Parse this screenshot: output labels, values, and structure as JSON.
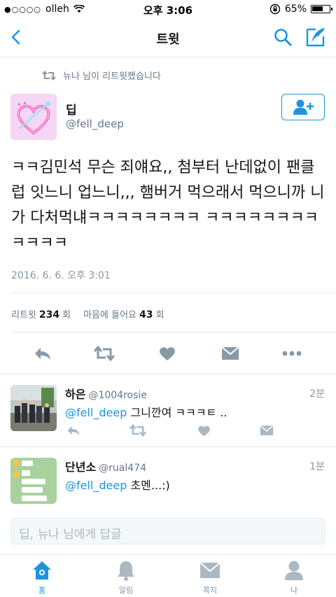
{
  "status_bar": {
    "signal": "●○○○○",
    "carrier": "olleh",
    "time": "오후 3:06",
    "battery": "65%",
    "battery_level": 0.65
  },
  "nav": {
    "title": "트윗"
  },
  "retweet_context": "뉴나 님이 리트윗했습니다",
  "tweet": {
    "author_name": "딥",
    "author_handle": "@fell_deep",
    "text": "ㅋㅋ김민석 무슨 죄얘요,, 첨부터 난데없이 팬클럽 잇느니 업느니,,, 햄버거 먹으래서 먹으니까 니가 다처먹냬ㅋㅋㅋㅋㅋㅋㅋㅋ ㅋㅋㅋㅋㅋㅋㅋㅋㅋㅋㅋㅋ",
    "timestamp": "2016. 6. 6. 오후 3:01",
    "retweet_label": "리트윗",
    "retweet_count": "234",
    "retweet_unit": "회",
    "like_label": "마음에 들어요",
    "like_count": "43",
    "like_unit": "회"
  },
  "replies": [
    {
      "name": "하은",
      "handle": "@1004rosie",
      "ago": "2분",
      "mention": "@fell_deep",
      "text": " 그니깐여 ㅋㅋㅋㅌ .."
    },
    {
      "name": "단년소",
      "handle": "@rual474",
      "ago": "1분",
      "mention": "@fell_deep",
      "text": " 초멘...:)"
    }
  ],
  "reply_box": {
    "placeholder": "딥, 뉴나 님에게 답글"
  },
  "tabs": [
    {
      "label": "홈",
      "icon": "home-icon",
      "active": true
    },
    {
      "label": "알림",
      "icon": "bell-icon",
      "active": false
    },
    {
      "label": "쪽지",
      "icon": "envelope-icon",
      "active": false
    },
    {
      "label": "나",
      "icon": "person-icon",
      "active": false
    }
  ],
  "colors": {
    "accent": "#1b95e0",
    "muted": "#657786",
    "icon_gray": "#8899a6",
    "divider": "#e1e8ed"
  }
}
